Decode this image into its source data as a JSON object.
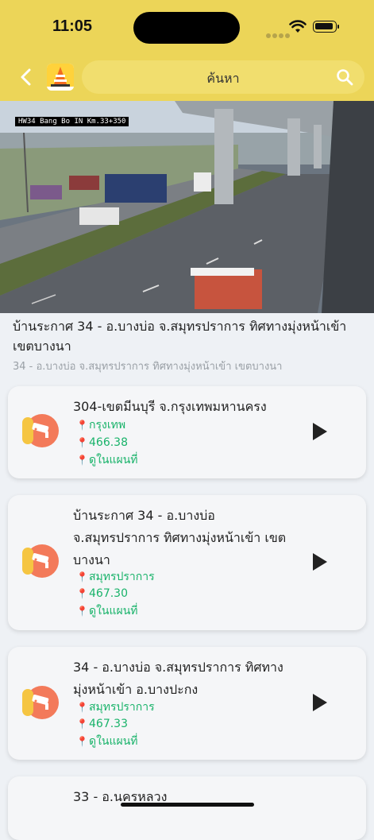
{
  "status": {
    "time": "11:05"
  },
  "header": {
    "search_label": "ค้นหา"
  },
  "video": {
    "camera_label": "HW34 Bang Bo IN Km.33+350"
  },
  "current": {
    "title": "บ้านระกาศ 34 - อ.บางบ่อ จ.สมุทรปราการ ทิศทางมุ่งหน้าเข้า เขตบางนา",
    "subtitle": "34 - อ.บางบ่อ จ.สมุทรปราการ ทิศทางมุ่งหน้าเข้า เขตบางนา"
  },
  "list": [
    {
      "title": "304-เขตมีนบุรี จ.กรุงเทพมหานครง",
      "province": "กรุงเทพ",
      "km": "466.38",
      "map": "ดูในแผนที่"
    },
    {
      "title": "บ้านระกาศ 34 - อ.บางบ่อ จ.สมุทรปราการ ทิศทางมุ่งหน้าเข้า เขตบางนา",
      "province": "สมุทรปราการ",
      "km": "467.30",
      "map": "ดูในแผนที่"
    },
    {
      "title": "34 - อ.บางบ่อ จ.สมุทรปราการ ทิศทางมุ่งหน้าเข้า อ.บางปะกง",
      "province": "สมุทรปราการ",
      "km": "467.33",
      "map": "ดูในแผนที่"
    },
    {
      "title": "33 - อ.นครหลวง"
    }
  ],
  "colors": {
    "header": "#ecd558",
    "accent_green": "#19b36a",
    "avatar": "#f37a5a"
  }
}
